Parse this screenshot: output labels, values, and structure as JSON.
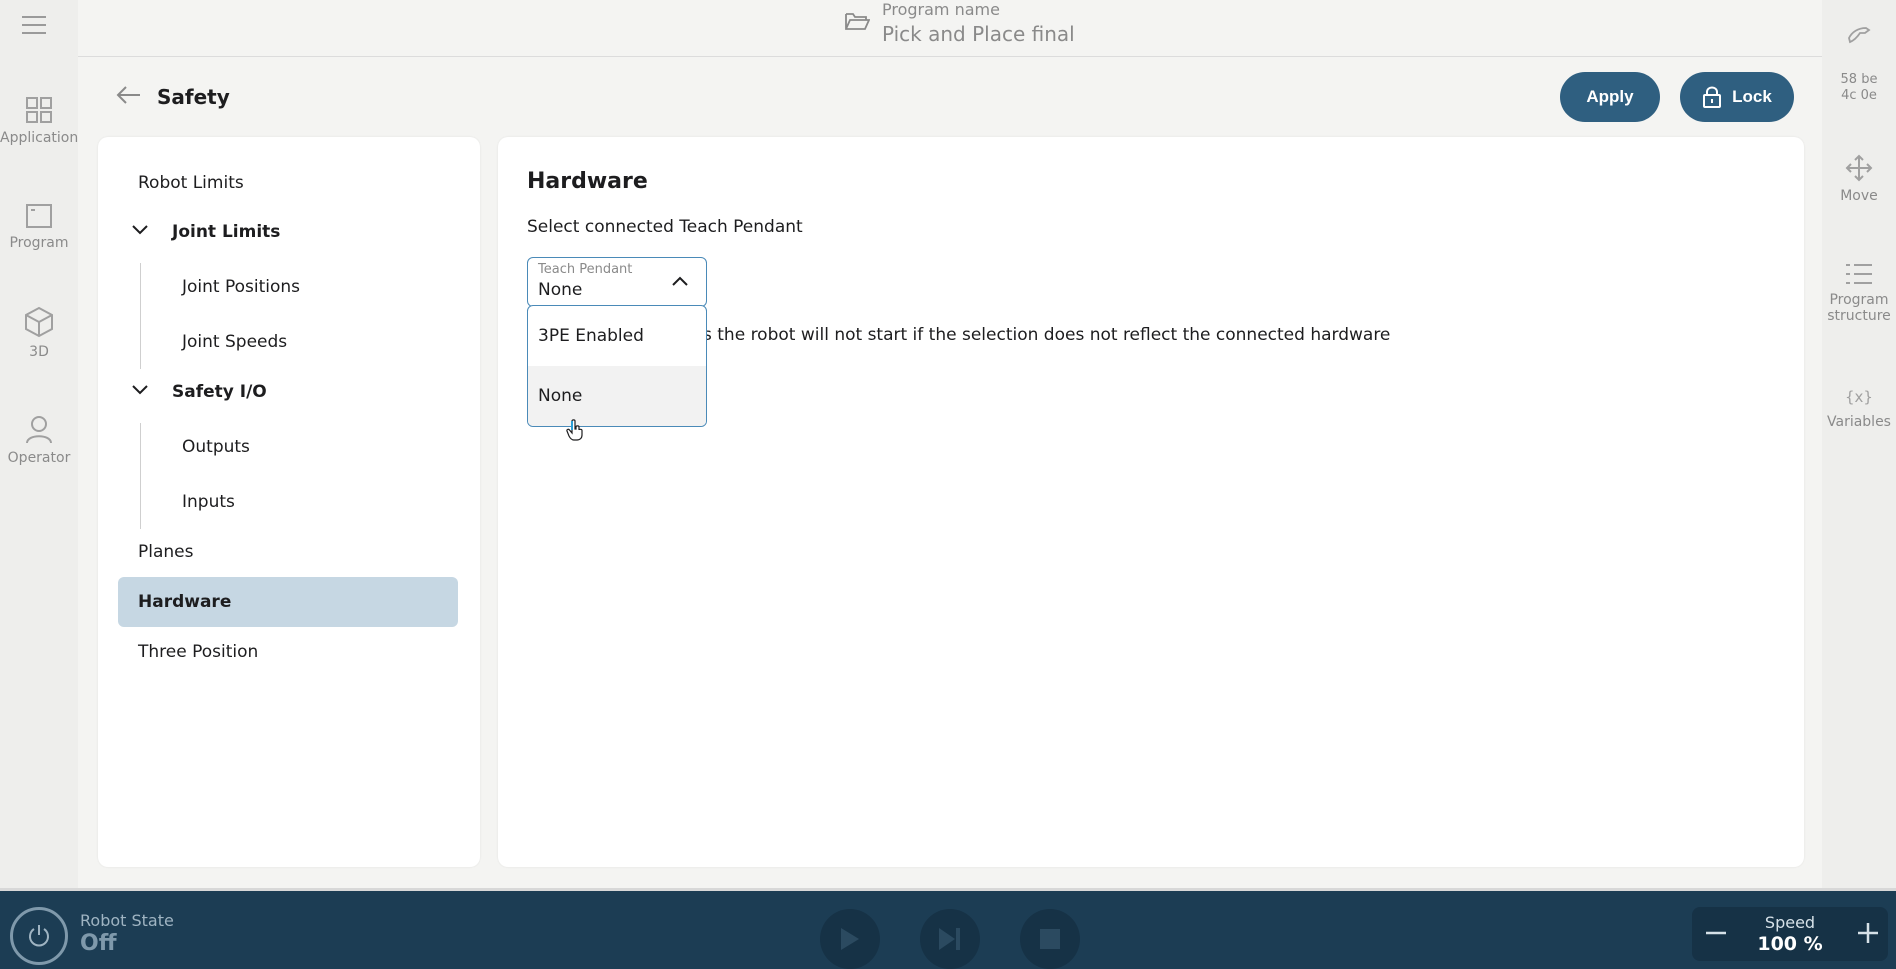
{
  "header": {
    "program_label": "Program name",
    "program_name": "Pick and Place final"
  },
  "left_rail": {
    "items": [
      {
        "label": "Application",
        "icon": "grid-icon"
      },
      {
        "label": "Program",
        "icon": "window-icon"
      },
      {
        "label": "3D",
        "icon": "cube-icon"
      },
      {
        "label": "Operator",
        "icon": "person-icon"
      }
    ]
  },
  "right_rail": {
    "id_line1": "58 be",
    "id_line2": "4c 0e",
    "items": [
      {
        "label": "Move",
        "icon": "move-arrows-icon"
      },
      {
        "label": "Program structure",
        "icon": "list-icon"
      },
      {
        "label": "Variables",
        "icon": "variables-icon"
      }
    ]
  },
  "page": {
    "title": "Safety",
    "apply_label": "Apply",
    "lock_label": "Lock"
  },
  "nav": {
    "items": {
      "robot_limits": "Robot Limits",
      "joint_limits": "Joint Limits",
      "joint_positions": "Joint Positions",
      "joint_speeds": "Joint Speeds",
      "safety_io": "Safety I/O",
      "outputs": "Outputs",
      "inputs": "Inputs",
      "planes": "Planes",
      "hardware": "Hardware",
      "three_position": "Three Position"
    },
    "selected": "Hardware"
  },
  "content": {
    "title": "Hardware",
    "subtitle": "Select connected Teach Pendant",
    "select": {
      "label": "Teach Pendant",
      "value": "None",
      "options": [
        "3PE Enabled",
        "None"
      ]
    },
    "info_visible": "s the robot will not start if the selection does not reflect the connected hardware"
  },
  "bottom": {
    "robot_state_label": "Robot State",
    "robot_state_value": "Off",
    "speed_label": "Speed",
    "speed_value": "100 %"
  },
  "colors": {
    "accent": "#2f5f80",
    "selected_nav": "#c6d7e3",
    "bottom_bar": "#1c3d54",
    "focus_border": "#4a8ab8"
  }
}
